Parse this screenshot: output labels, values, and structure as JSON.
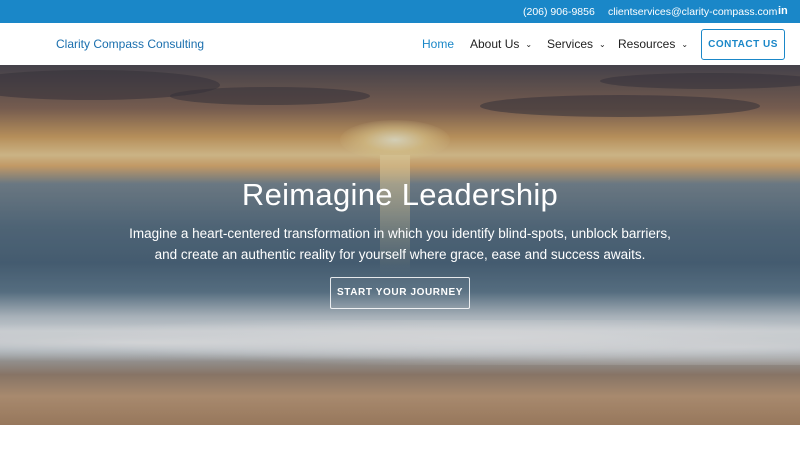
{
  "topbar": {
    "phone": "(206) 906-9856",
    "email": "clientservices@clarity-compass.com",
    "linkedin_icon": "in"
  },
  "nav": {
    "logo": "Clarity Compass Consulting",
    "items": [
      {
        "label": "Home",
        "active": true
      },
      {
        "label": "About Us",
        "dropdown": true
      },
      {
        "label": "Services",
        "dropdown": true
      },
      {
        "label": "Resources",
        "dropdown": true
      }
    ],
    "contact_label": "CONTACT US"
  },
  "hero": {
    "title": "Reimagine Leadership",
    "subtitle": "Imagine a heart-centered transformation in which you identify blind-spots, unblock barriers, and create an authentic reality for yourself where grace, ease and success awaits.",
    "cta_label": "START YOUR JOURNEY"
  },
  "colors": {
    "brand_blue": "#1a87c8",
    "logo_blue": "#1a6fae"
  }
}
